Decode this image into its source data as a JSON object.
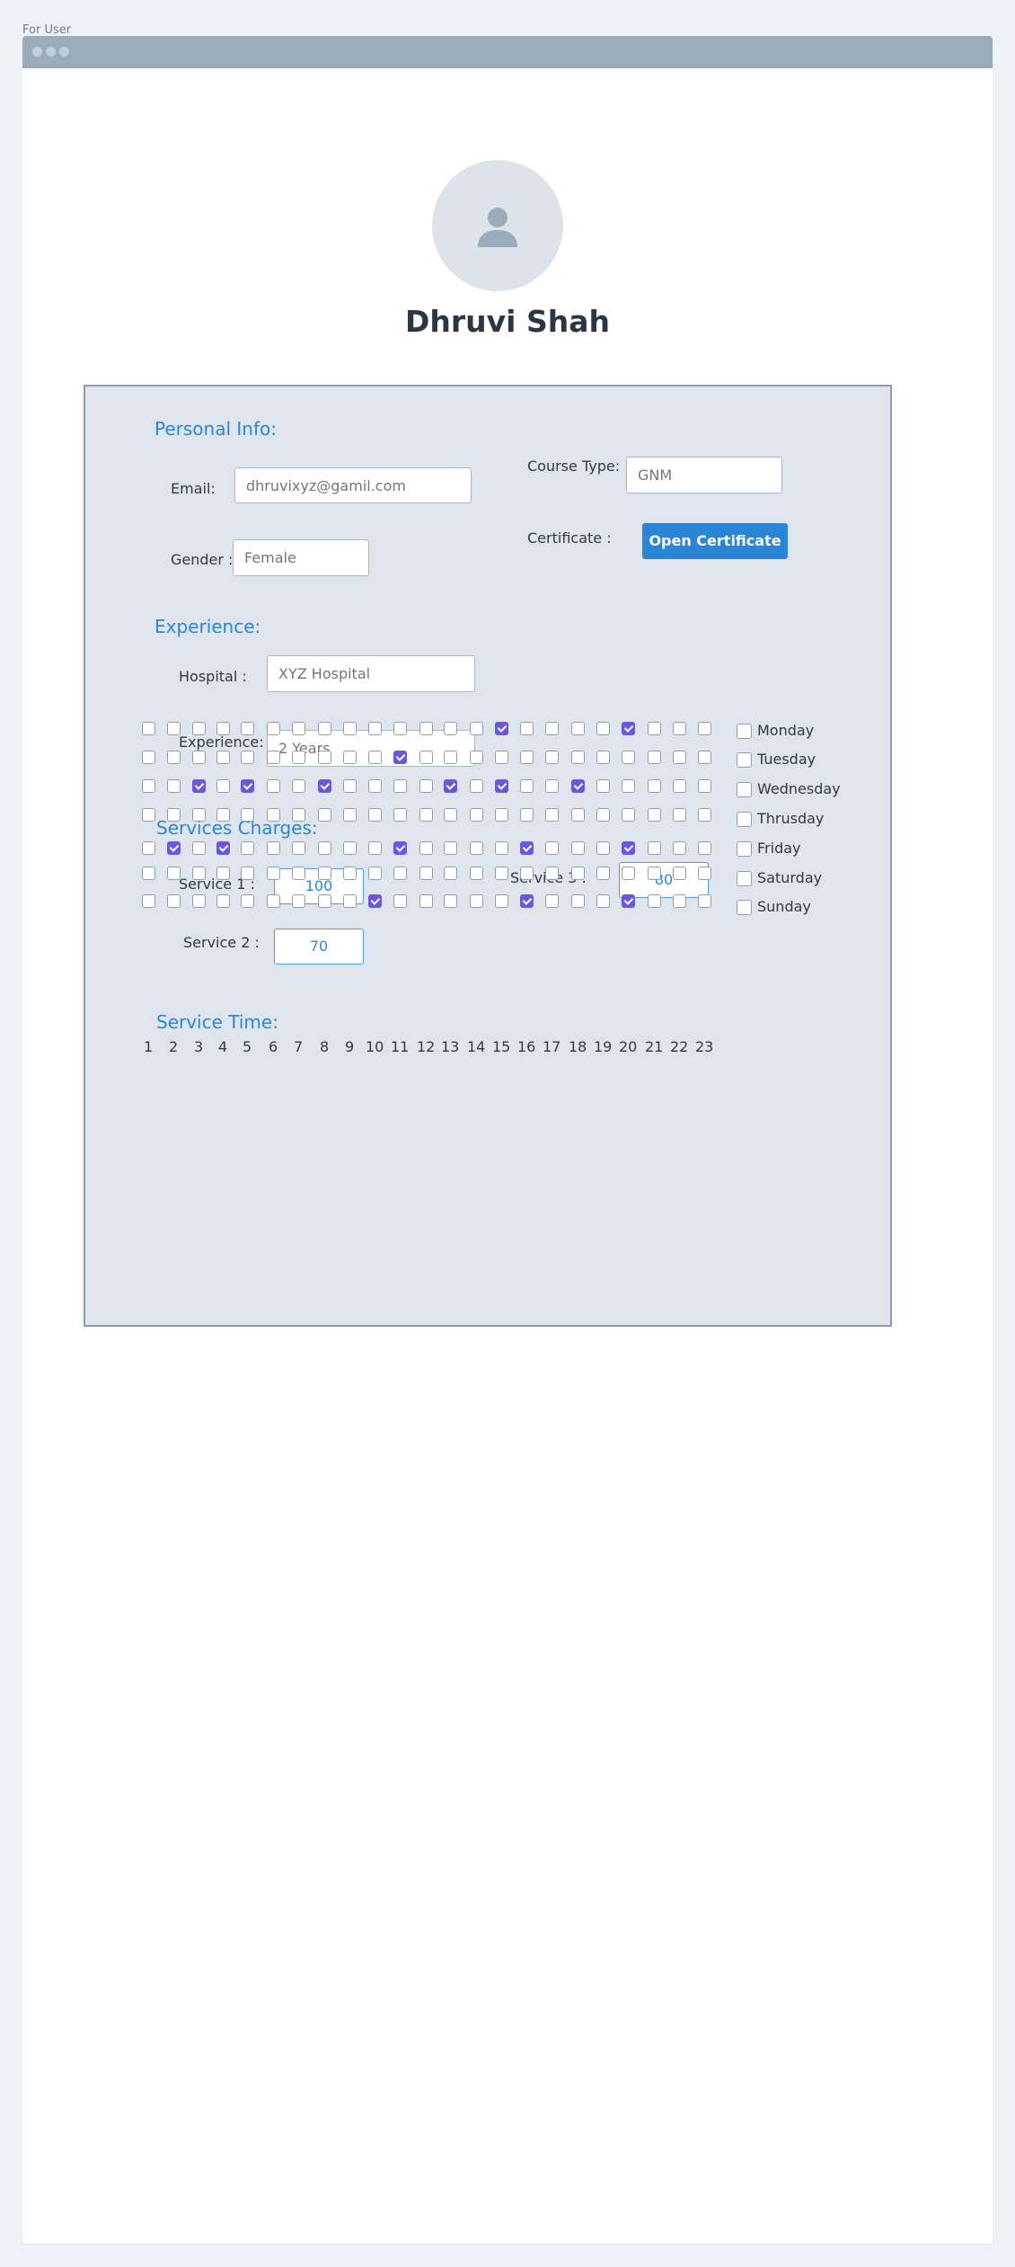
{
  "page_label": "For User",
  "profile": {
    "name": "Dhruvi Shah"
  },
  "personal_info": {
    "title": "Personal Info:",
    "email_label": "Email:",
    "email_value": "dhruvixyz@gamil.com",
    "gender_label": "Gender :",
    "gender_value": "Female",
    "course_type_label": "Course Type:",
    "course_type_value": "GNM",
    "certificate_label": "Certificate :",
    "certificate_button": "Open Certificate"
  },
  "experience": {
    "title": "Experience:",
    "hospital_label": "Hospital :",
    "hospital_value": "XYZ Hospital",
    "experience_label": "Experience:",
    "experience_value": "2 Years"
  },
  "services": {
    "title": "Services Charges:",
    "service1_label": "Service 1 :",
    "service1_value": "100",
    "service2_label": "Service 2 :",
    "service2_value": "70",
    "service3_label": "Service 3 :",
    "service3_value": "80"
  },
  "service_time": {
    "title": "Service Time:",
    "hours": [
      "1",
      "2",
      "3",
      "4",
      "5",
      "6",
      "7",
      "8",
      "9",
      "10",
      "11",
      "12",
      "13",
      "14",
      "15",
      "16",
      "17",
      "18",
      "19",
      "20",
      "21",
      "22",
      "23"
    ],
    "days": [
      {
        "name": "Monday",
        "checked": false,
        "slots": [
          15,
          20
        ]
      },
      {
        "name": "Tuesday",
        "checked": false,
        "slots": [
          11
        ]
      },
      {
        "name": "Wednesday",
        "checked": false,
        "slots": [
          3,
          5,
          8,
          13,
          15,
          18
        ]
      },
      {
        "name": "Thrusday",
        "checked": false,
        "slots": []
      },
      {
        "name": "Friday",
        "checked": false,
        "slots": [
          2,
          4,
          11,
          16,
          20
        ]
      },
      {
        "name": "Saturday",
        "checked": false,
        "slots": []
      },
      {
        "name": "Sunday",
        "checked": false,
        "slots": [
          10,
          16,
          20
        ]
      }
    ]
  }
}
